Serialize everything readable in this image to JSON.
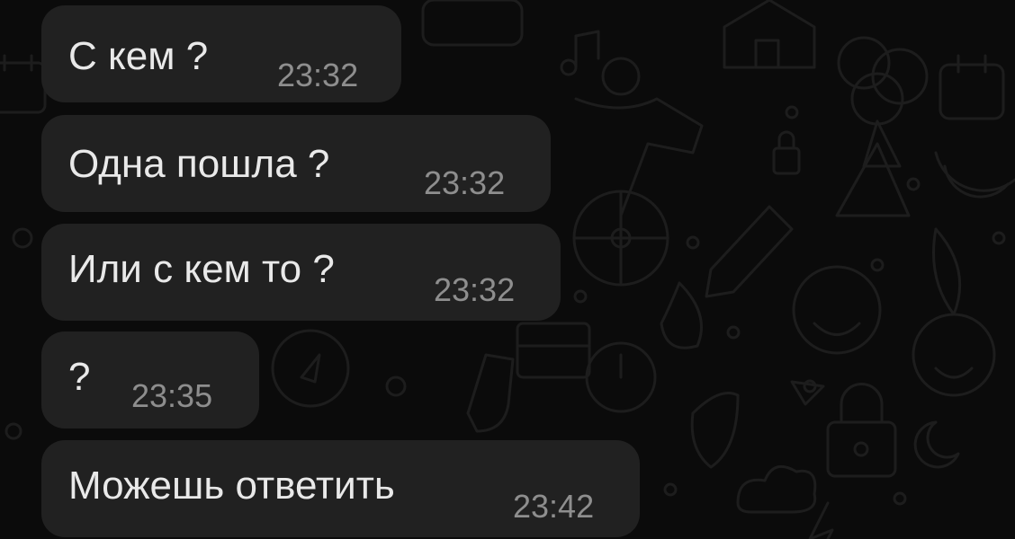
{
  "background": {
    "color": "#0b0b0b",
    "pattern": "doodle-wallpaper"
  },
  "messages": [
    {
      "text": "С кем ?",
      "time": "23:32"
    },
    {
      "text": "Одна пошла ?",
      "time": "23:32"
    },
    {
      "text": "Или с кем то ?",
      "time": "23:32"
    },
    {
      "text": "?",
      "time": "23:35"
    },
    {
      "text": "Можешь ответить",
      "time": "23:42"
    }
  ],
  "colors": {
    "bubble": "#212121",
    "text": "#e9e9e9",
    "time": "#8e8e8e"
  }
}
